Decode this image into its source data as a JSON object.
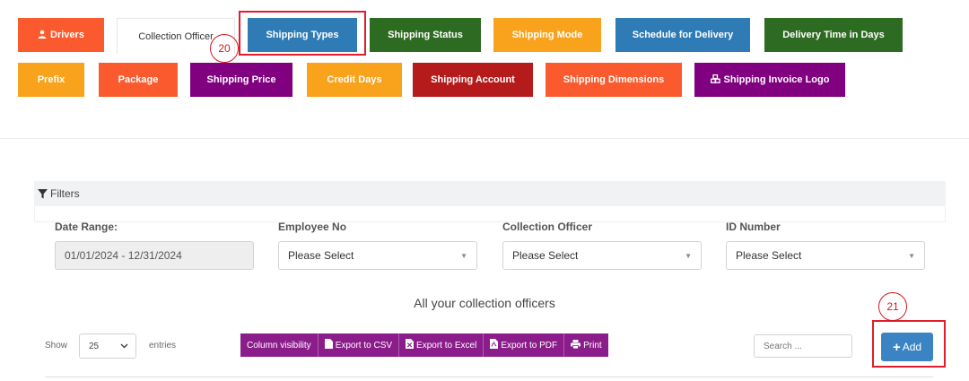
{
  "tabs_row1": [
    {
      "label": "Drivers",
      "color": "#fa5a2d",
      "icon": "user-icon"
    },
    {
      "label": "Collection Officer",
      "color": "#ffffff",
      "active": true
    },
    {
      "label": "Shipping Types",
      "color": "#2f7bb5"
    },
    {
      "label": "Shipping Status",
      "color": "#2e6b22"
    },
    {
      "label": "Shipping Mode",
      "color": "#f9a21b"
    },
    {
      "label": "Schedule for Delivery",
      "color": "#2f7bb5"
    },
    {
      "label": "Delivery Time in Days",
      "color": "#2e6b22"
    }
  ],
  "tabs_row2": [
    {
      "label": "Prefix",
      "color": "#f9a21b"
    },
    {
      "label": "Package",
      "color": "#fa5a2d"
    },
    {
      "label": "Shipping Price",
      "color": "#800080"
    },
    {
      "label": "Credit Days",
      "color": "#f9a21b"
    },
    {
      "label": "Shipping Account",
      "color": "#b51b1b"
    },
    {
      "label": "Shipping Dimensions",
      "color": "#fa5a2d"
    },
    {
      "label": "Shipping Invoice Logo",
      "color": "#800080",
      "icon": "cubes-icon"
    }
  ],
  "annotations": {
    "marker1": "20",
    "marker2": "21"
  },
  "filters": {
    "title": "Filters",
    "date_range": {
      "label": "Date Range:",
      "value": "01/01/2024 - 12/31/2024"
    },
    "employee_no": {
      "label": "Employee No",
      "value": "Please Select"
    },
    "collection_officer": {
      "label": "Collection Officer",
      "value": "Please Select"
    },
    "id_number": {
      "label": "ID Number",
      "value": "Please Select"
    }
  },
  "table": {
    "caption": "All your collection officers",
    "show_label": "Show",
    "page_length": "25",
    "entries_label": "entries",
    "export_buttons": [
      "Column visibility",
      "Export to CSV",
      "Export to Excel",
      "Export to PDF",
      "Print"
    ],
    "search_placeholder": "Search ...",
    "add_label": "Add"
  },
  "colors": {
    "accent_blue": "#3a84c4",
    "export_purple": "#8b1d8b",
    "highlight_red": "#e11d2b"
  }
}
